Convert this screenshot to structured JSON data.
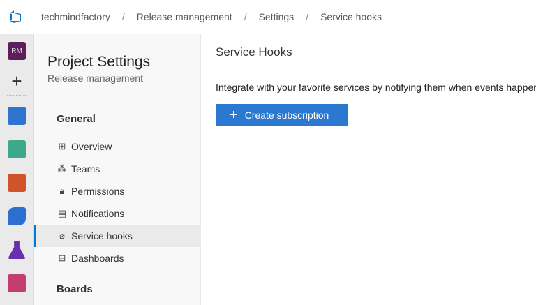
{
  "header": {
    "breadcrumbs": [
      "techmindfactory",
      "Release management",
      "Settings",
      "Service hooks"
    ],
    "separator": "/"
  },
  "rail": {
    "avatar": "RM",
    "items": [
      "add",
      "boards",
      "repos-tests",
      "repos",
      "pipelines",
      "test-plans",
      "artifacts"
    ]
  },
  "panel": {
    "title": "Project Settings",
    "subtitle": "Release management",
    "sections": [
      {
        "label": "General",
        "items": [
          {
            "label": "Overview",
            "icon": "overview-icon"
          },
          {
            "label": "Teams",
            "icon": "teams-icon"
          },
          {
            "label": "Permissions",
            "icon": "lock-icon"
          },
          {
            "label": "Notifications",
            "icon": "chat-icon"
          },
          {
            "label": "Service hooks",
            "icon": "plug-icon",
            "active": true
          },
          {
            "label": "Dashboards",
            "icon": "dashboard-icon"
          }
        ]
      },
      {
        "label": "Boards",
        "items": []
      }
    ]
  },
  "main": {
    "title": "Service Hooks",
    "description": "Integrate with your favorite services by notifying them when events happen",
    "create_button": "Create subscription"
  },
  "colors": {
    "accent": "#2b78d0",
    "active_bar": "#0078d4"
  }
}
